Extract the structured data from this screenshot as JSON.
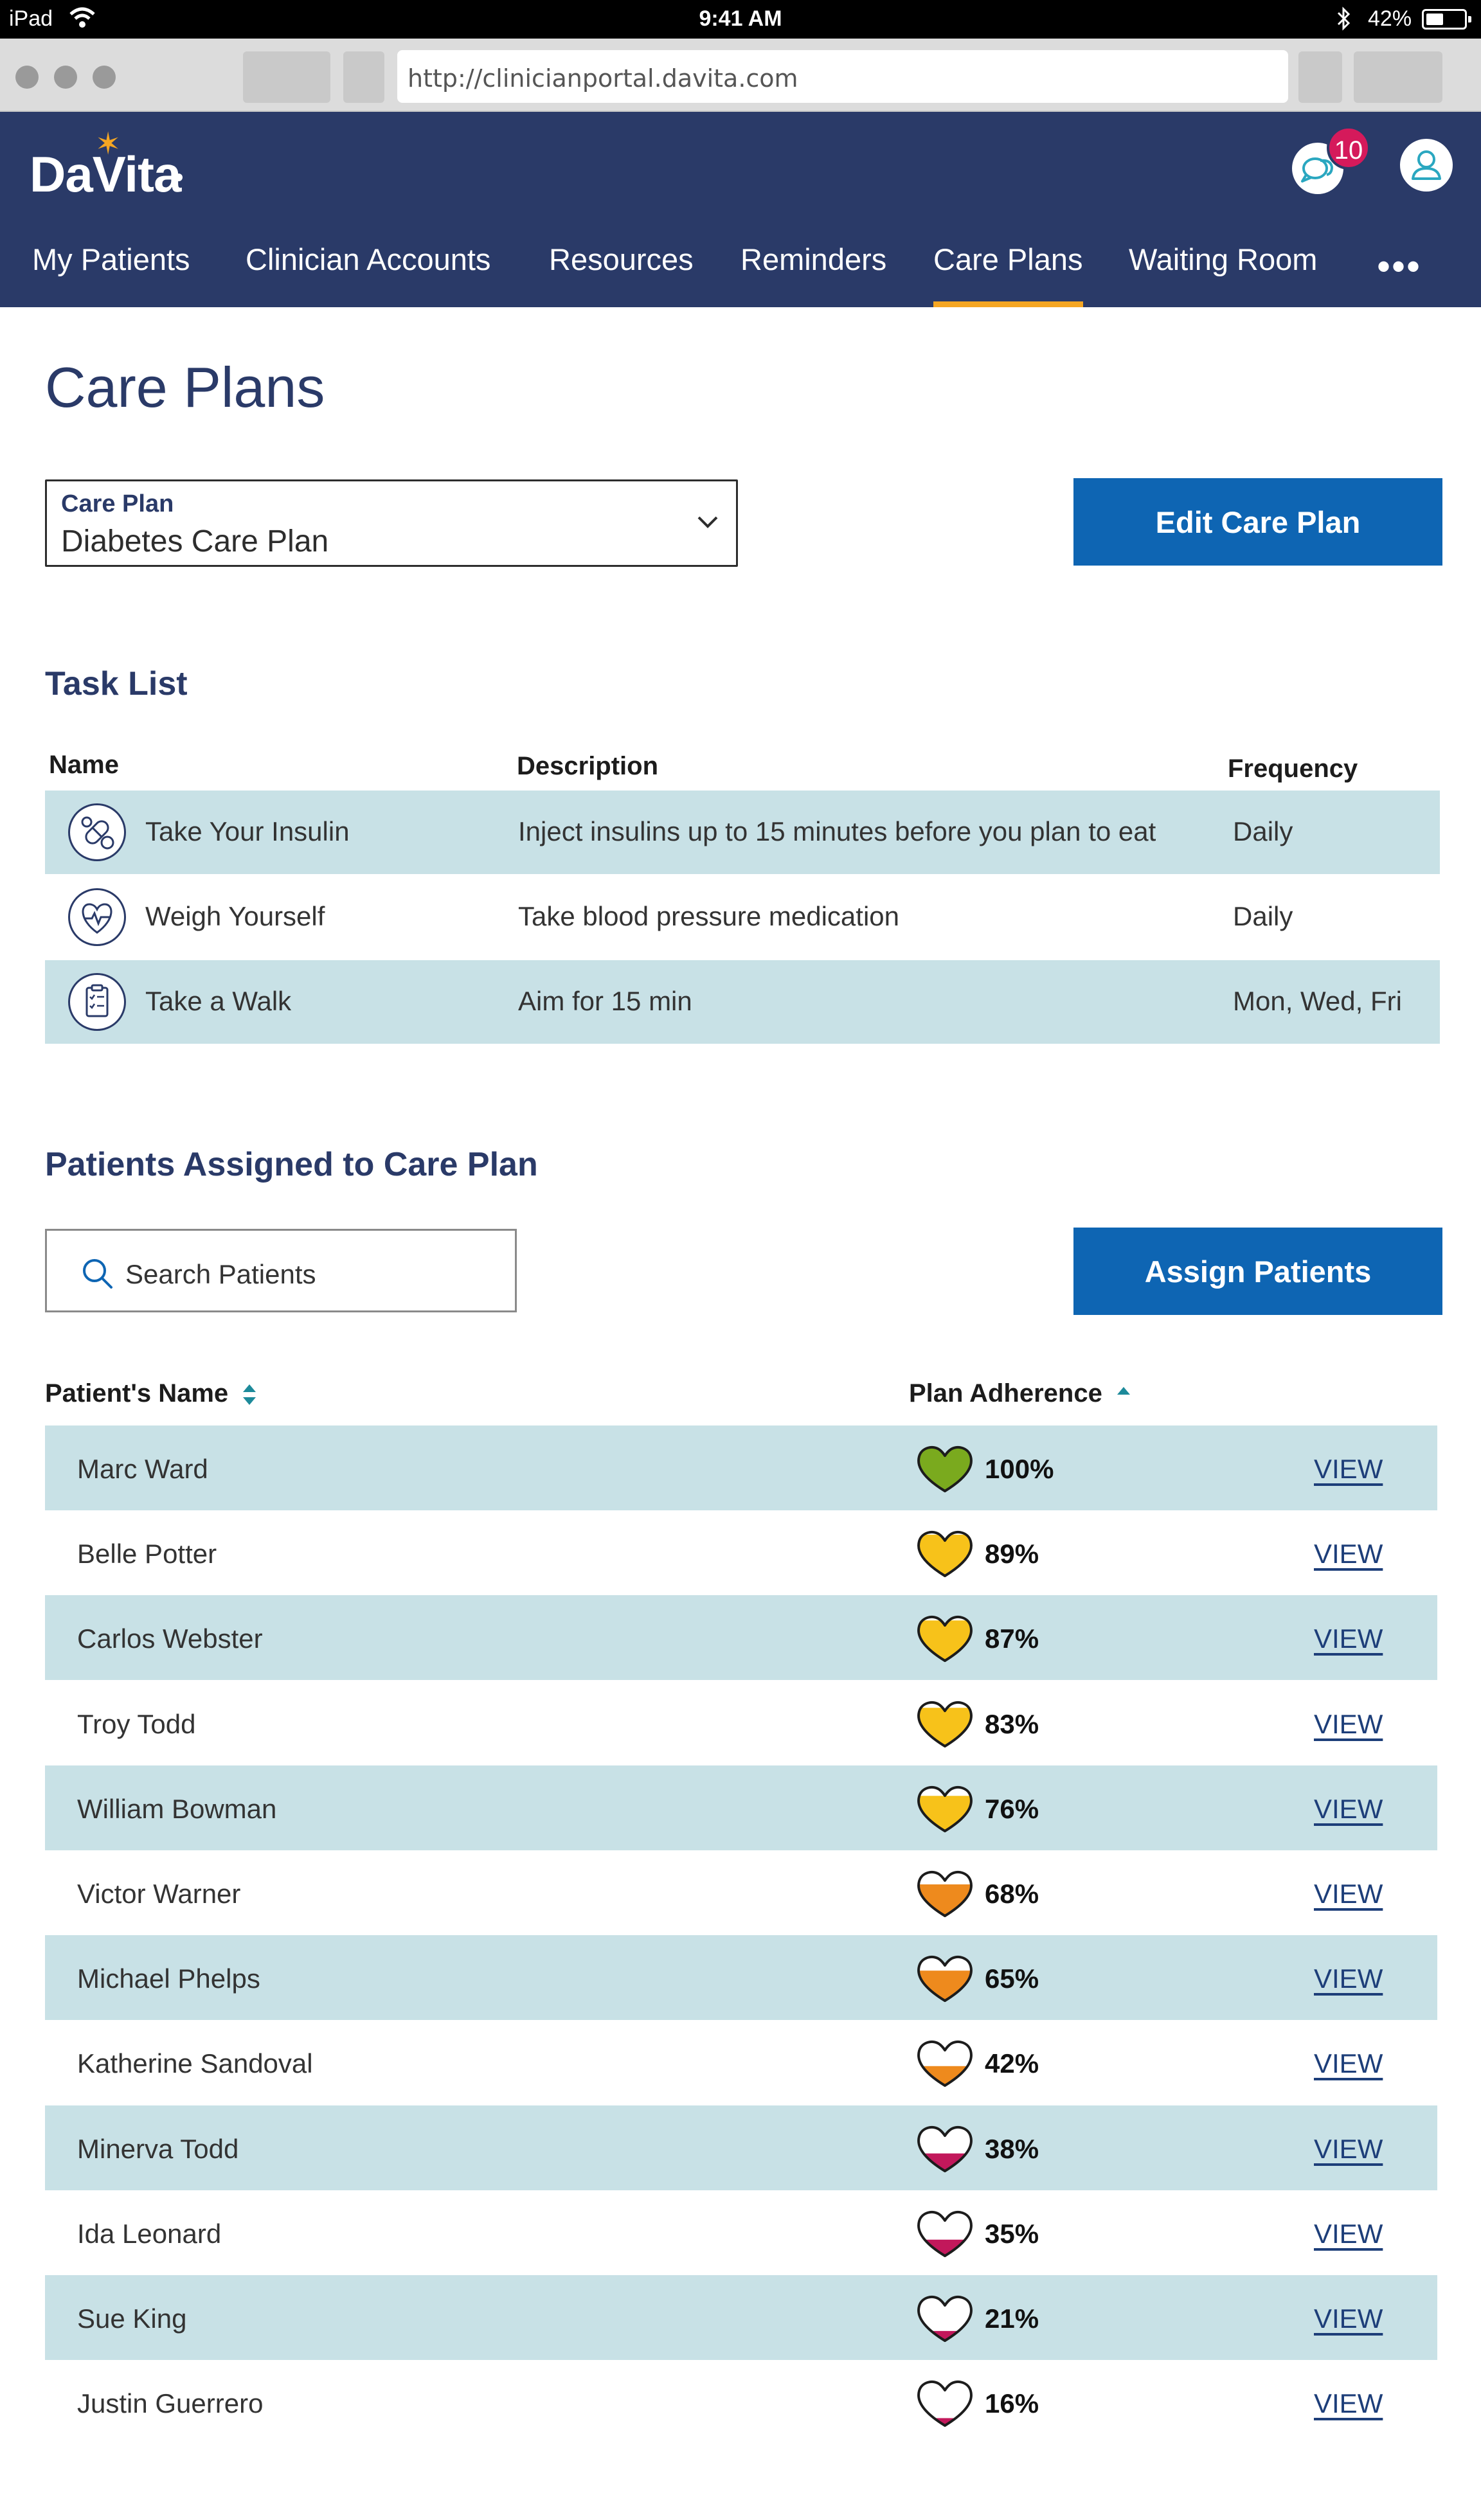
{
  "status_bar": {
    "carrier": "iPad",
    "time": "9:41 AM",
    "battery": "42%"
  },
  "browser": {
    "url": "http://clinicianportal.davita.com"
  },
  "header": {
    "logo": "DaVita",
    "message_count": "10",
    "nav": [
      {
        "label": "My Patients"
      },
      {
        "label": "Clinician Accounts"
      },
      {
        "label": "Resources"
      },
      {
        "label": "Reminders"
      },
      {
        "label": "Care Plans",
        "active": true
      },
      {
        "label": "Waiting Room"
      }
    ],
    "more_label": "•••"
  },
  "page": {
    "title": "Care Plans",
    "care_plan_select": {
      "label": "Care Plan",
      "value": "Diabetes Care Plan"
    },
    "edit_button": "Edit Care Plan"
  },
  "tasks": {
    "title": "Task List",
    "headers": {
      "name": "Name",
      "description": "Description",
      "frequency": "Frequency"
    },
    "rows": [
      {
        "icon": "pills-icon",
        "name": "Take Your Insulin",
        "description": "Inject insulins up to 15 minutes before you plan to eat",
        "frequency": "Daily"
      },
      {
        "icon": "heart-pulse-icon",
        "name": "Weigh Yourself",
        "description": "Take blood pressure medication",
        "frequency": "Daily"
      },
      {
        "icon": "clipboard-icon",
        "name": "Take a Walk",
        "description": "Aim for 15 min",
        "frequency": "Mon, Wed, Fri"
      }
    ]
  },
  "patients": {
    "title": "Patients Assigned to Care Plan",
    "search_placeholder": "Search Patients",
    "assign_button": "Assign Patients",
    "headers": {
      "name": "Patient's Name",
      "adherence": "Plan Adherence"
    },
    "view_label": "VIEW",
    "colors": {
      "full": "#7aaa1e",
      "high": "#f7c21a",
      "mid": "#ee8a1d",
      "low": "#c2185b"
    },
    "rows": [
      {
        "name": "Marc Ward",
        "adherence": "100%",
        "level": 1.0
      },
      {
        "name": "Belle Potter",
        "adherence": "89%",
        "level": 0.89
      },
      {
        "name": "Carlos Webster",
        "adherence": "87%",
        "level": 0.87
      },
      {
        "name": "Troy Todd",
        "adherence": "83%",
        "level": 0.83
      },
      {
        "name": "William Bowman",
        "adherence": "76%",
        "level": 0.76
      },
      {
        "name": "Victor Warner",
        "adherence": "68%",
        "level": 0.68
      },
      {
        "name": "Michael Phelps",
        "adherence": "65%",
        "level": 0.65
      },
      {
        "name": "Katherine Sandoval",
        "adherence": "42%",
        "level": 0.42
      },
      {
        "name": "Minerva Todd",
        "adherence": "38%",
        "level": 0.38
      },
      {
        "name": "Ida Leonard",
        "adherence": "35%",
        "level": 0.35
      },
      {
        "name": "Sue King",
        "adherence": "21%",
        "level": 0.21
      },
      {
        "name": "Justin Guerrero",
        "adherence": "16%",
        "level": 0.16
      }
    ]
  }
}
